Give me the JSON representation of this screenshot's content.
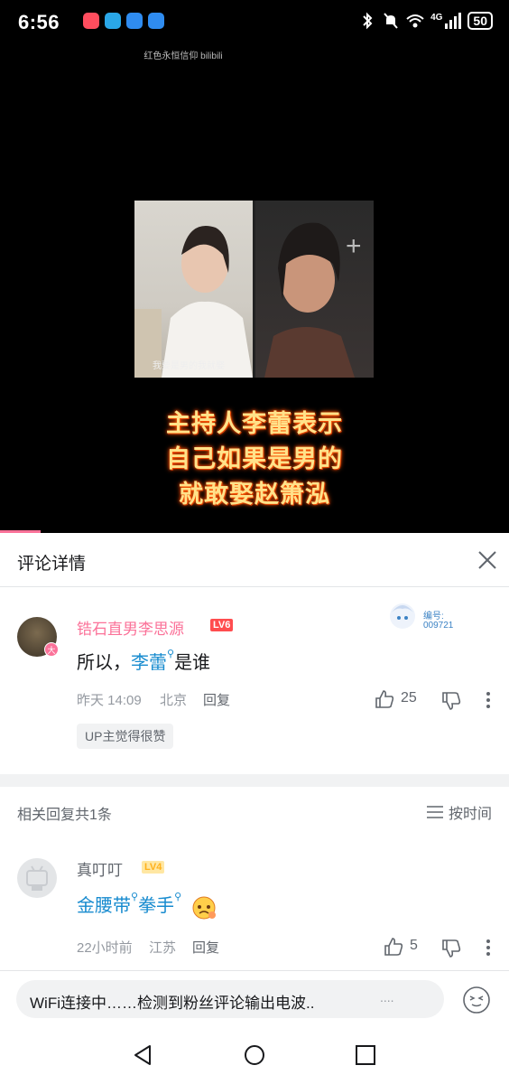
{
  "status_bar": {
    "time": "6:56",
    "network": "4G",
    "battery": "50",
    "app_icon_colors": [
      "#ff4d5e",
      "#2aa7e8",
      "#2f8cf0",
      "#2f8cf0"
    ],
    "icons": [
      "bluetooth-icon",
      "mute-icon",
      "wifi-icon",
      "signal-icon",
      "battery-icon"
    ]
  },
  "video": {
    "watermark": "红色永恒信仰 bilibili",
    "inner_subtitle": "我要是男的我就娶",
    "caption_lines": [
      "主持人李蕾表示",
      "自己如果是男的",
      "就敢娶赵箫泓"
    ],
    "progress_fraction": 0.08,
    "caption_color": "#ffe28a"
  },
  "panel": {
    "title": "评论详情",
    "close_icon": "close-icon"
  },
  "main_comment": {
    "username": "锆石直男李思源",
    "level": "LV6",
    "avatar_badge": "大",
    "fan_badge_label": "编号:",
    "fan_badge_number": "009721",
    "text_before": "所以，",
    "keyword": "李蕾",
    "text_after": "是谁",
    "time": "昨天 14:09",
    "location": "北京",
    "reply_label": "回复",
    "likes": "25",
    "up_tag": "UP主觉得很赞"
  },
  "replies_header": {
    "count_text": "相关回复共1条",
    "sort_label": "按时间"
  },
  "reply": {
    "username": "真叮叮",
    "level": "LV4",
    "keyword1": "金腰带",
    "keyword2": "拳手",
    "time": "22小时前",
    "location": "江苏",
    "reply_label": "回复",
    "likes": "5"
  },
  "input_bar": {
    "placeholder": "WiFi连接中……检测到粉丝评论输出电波..",
    "trailing_dots": "....",
    "emoji_icon": "emoji-icon"
  },
  "nav_bar": {
    "icons": [
      "back-triangle-icon",
      "home-circle-icon",
      "recents-square-icon"
    ]
  },
  "colors": {
    "accent_pink": "#fb7299",
    "link_blue": "#178bcf",
    "text_secondary": "#9499a0"
  }
}
